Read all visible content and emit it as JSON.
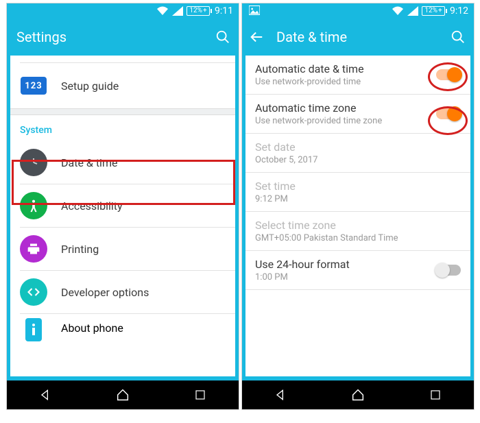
{
  "left": {
    "status": {
      "battery": "12%",
      "time": "9:11"
    },
    "appbar": {
      "title": "Settings"
    },
    "rows": {
      "setup": {
        "label": "Setup guide",
        "icon_text": "123"
      },
      "section": {
        "label": "System"
      },
      "datetime": {
        "label": "Date & time"
      },
      "accessibility": {
        "label": "Accessibility"
      },
      "printing": {
        "label": "Printing"
      },
      "developer": {
        "label": "Developer options"
      },
      "about": {
        "label": "About phone"
      }
    }
  },
  "right": {
    "status": {
      "battery": "12%",
      "time": "9:12"
    },
    "appbar": {
      "title": "Date & time"
    },
    "items": {
      "auto_dt": {
        "title": "Automatic date & time",
        "sub": "Use network-provided time",
        "on": true
      },
      "auto_tz": {
        "title": "Automatic time zone",
        "sub": "Use network-provided time zone",
        "on": true
      },
      "set_date": {
        "title": "Set date",
        "sub": "October 5, 2017"
      },
      "set_time": {
        "title": "Set time",
        "sub": "9:12 PM"
      },
      "sel_tz": {
        "title": "Select time zone",
        "sub": "GMT+05:00 Pakistan Standard Time"
      },
      "use24": {
        "title": "Use 24-hour format",
        "sub": "1:00 PM",
        "on": false
      }
    }
  }
}
